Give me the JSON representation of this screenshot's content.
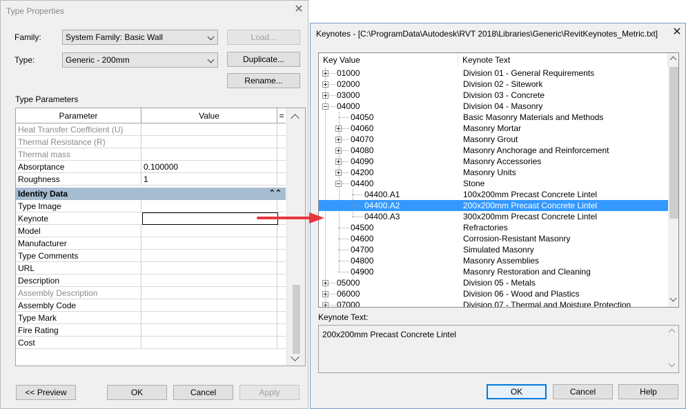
{
  "type_properties": {
    "title": "Type Properties",
    "family_label": "Family:",
    "family_value": "System Family: Basic Wall",
    "type_label": "Type:",
    "type_value": "Generic - 200mm",
    "load_button": "Load...",
    "duplicate_button": "Duplicate...",
    "rename_button": "Rename...",
    "section_label": "Type Parameters",
    "col_parameter": "Parameter",
    "col_value": "Value",
    "col_equals": "=",
    "rows_top": [
      {
        "param": "Heat Transfer Coefficient (U)",
        "value": "",
        "disabled": true
      },
      {
        "param": "Thermal Resistance (R)",
        "value": "",
        "disabled": true
      },
      {
        "param": "Thermal mass",
        "value": "",
        "disabled": true
      },
      {
        "param": "Absorptance",
        "value": "0.100000",
        "disabled": false
      },
      {
        "param": "Roughness",
        "value": "1",
        "disabled": false
      }
    ],
    "group_identity": "Identity Data",
    "rows_identity": [
      {
        "param": "Type Image",
        "value": "",
        "disabled": false
      },
      {
        "param": "Keynote",
        "value": "",
        "disabled": false
      },
      {
        "param": "Model",
        "value": "",
        "disabled": false
      },
      {
        "param": "Manufacturer",
        "value": "",
        "disabled": false
      },
      {
        "param": "Type Comments",
        "value": "",
        "disabled": false
      },
      {
        "param": "URL",
        "value": "",
        "disabled": false
      },
      {
        "param": "Description",
        "value": "",
        "disabled": false
      },
      {
        "param": "Assembly Description",
        "value": "",
        "disabled": true
      },
      {
        "param": "Assembly Code",
        "value": "",
        "disabled": false
      },
      {
        "param": "Type Mark",
        "value": "",
        "disabled": false
      },
      {
        "param": "Fire Rating",
        "value": "",
        "disabled": false
      },
      {
        "param": "Cost",
        "value": "",
        "disabled": false
      }
    ],
    "preview_button": "<< Preview",
    "ok_button": "OK",
    "cancel_button": "Cancel",
    "apply_button": "Apply"
  },
  "keynotes": {
    "title": "Keynotes - [C:\\ProgramData\\Autodesk\\RVT 2018\\Libraries\\Generic\\RevitKeynotes_Metric.txt]",
    "col_key": "Key Value",
    "col_text": "Keynote Text",
    "rows": [
      {
        "key": "01000",
        "text": "Division 01 - General Requirements",
        "level": 0,
        "toggle": "plus"
      },
      {
        "key": "02000",
        "text": "Division 02 - Sitework",
        "level": 0,
        "toggle": "plus"
      },
      {
        "key": "03000",
        "text": "Division 03 - Concrete",
        "level": 0,
        "toggle": "plus"
      },
      {
        "key": "04000",
        "text": "Division 04 - Masonry",
        "level": 0,
        "toggle": "minus"
      },
      {
        "key": "04050",
        "text": "Basic Masonry Materials and Methods",
        "level": 1,
        "toggle": "none"
      },
      {
        "key": "04060",
        "text": "Masonry Mortar",
        "level": 1,
        "toggle": "plus"
      },
      {
        "key": "04070",
        "text": "Masonry Grout",
        "level": 1,
        "toggle": "plus"
      },
      {
        "key": "04080",
        "text": "Masonry Anchorage and Reinforcement",
        "level": 1,
        "toggle": "plus"
      },
      {
        "key": "04090",
        "text": "Masonry Accessories",
        "level": 1,
        "toggle": "plus"
      },
      {
        "key": "04200",
        "text": "Masonry Units",
        "level": 1,
        "toggle": "plus"
      },
      {
        "key": "04400",
        "text": "Stone",
        "level": 1,
        "toggle": "minus"
      },
      {
        "key": "04400.A1",
        "text": "100x200mm Precast Concrete Lintel",
        "level": 2,
        "toggle": "none"
      },
      {
        "key": "04400.A2",
        "text": "200x200mm Precast Concrete Lintel",
        "level": 2,
        "toggle": "none",
        "selected": true
      },
      {
        "key": "04400.A3",
        "text": "300x200mm Precast Concrete Lintel",
        "level": 2,
        "toggle": "none"
      },
      {
        "key": "04500",
        "text": "Refractories",
        "level": 1,
        "toggle": "none"
      },
      {
        "key": "04600",
        "text": "Corrosion-Resistant Masonry",
        "level": 1,
        "toggle": "none"
      },
      {
        "key": "04700",
        "text": "Simulated Masonry",
        "level": 1,
        "toggle": "none"
      },
      {
        "key": "04800",
        "text": "Masonry Assemblies",
        "level": 1,
        "toggle": "none"
      },
      {
        "key": "04900",
        "text": "Masonry Restoration and Cleaning",
        "level": 1,
        "toggle": "none"
      },
      {
        "key": "05000",
        "text": "Division 05 - Metals",
        "level": 0,
        "toggle": "plus"
      },
      {
        "key": "06000",
        "text": "Division 06 - Wood and Plastics",
        "level": 0,
        "toggle": "plus"
      },
      {
        "key": "07000",
        "text": "Division 07 - Thermal and Moisture Protection",
        "level": 0,
        "toggle": "plus"
      }
    ],
    "keynote_text_label": "Keynote Text:",
    "keynote_text_value": "200x200mm Precast Concrete Lintel",
    "ok_button": "OK",
    "cancel_button": "Cancel",
    "help_button": "Help"
  },
  "colors": {
    "selection": "#3399ff",
    "group_header": "#a6bcd1",
    "arrow": "#e8363d"
  }
}
